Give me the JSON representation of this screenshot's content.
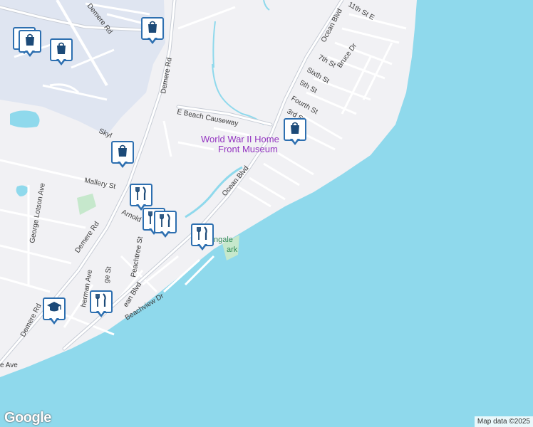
{
  "map": {
    "colors": {
      "land": "#f1f1f4",
      "water": "#8fd9ec",
      "marsh": "#dfe5f1",
      "road": "#ffffff",
      "major_road": "#c8cdd6",
      "park": "#c6e8cc",
      "pin_border": "#2d6fb0",
      "pin_icon": "#1c4a78",
      "poi_text": "#9334c0"
    },
    "streets": {
      "demere_rd_top": "Demere Rd",
      "demere_rd_mid": "Demere Rd",
      "demere_rd_lower": "Demere Rd",
      "demere_rd_bottom": "Demere Rd",
      "e_beach_causeway": "E Beach Causeway",
      "ocean_blvd_upper": "Ocean Blvd",
      "ocean_blvd_mid": "Ocean Blvd",
      "ocean_blvd_lower": "ean Blvd",
      "mallery_st": "Mallery St",
      "george_lotson_ave": "George Lotson Ave",
      "skyl": "Skyl",
      "arnold": "Arnold",
      "peachtree_st": "Peachtree St",
      "ge_st": "ge St",
      "herman_ave": "herman Ave",
      "beachview_dr": "Beachview Dr",
      "e_ave": "e Ave",
      "eleventh_st": "11th St E",
      "seventh_st": "7th St",
      "bruce_dr": "Bruce Dr",
      "sixth_st": "Sixth St",
      "fifth_st": "5th St",
      "fourth_st": "Fourth St",
      "third_st": "3rd St"
    },
    "poi": {
      "museum_line1": "World War II Home",
      "museum_line2": "Front Museum",
      "park_line1": "ngale",
      "park_line2": "ark"
    },
    "pins": [
      {
        "type": "shopping-bag",
        "icon": "shopping-bag-icon"
      },
      {
        "type": "shopping-bag",
        "icon": "shopping-bag-icon"
      },
      {
        "type": "shopping-bag",
        "icon": "shopping-bag-icon"
      },
      {
        "type": "shopping-bag",
        "icon": "shopping-bag-icon"
      },
      {
        "type": "shopping-bag",
        "icon": "shopping-bag-icon"
      },
      {
        "type": "shopping-bag",
        "icon": "shopping-bag-icon"
      },
      {
        "type": "restaurant",
        "icon": "fork-knife-icon"
      },
      {
        "type": "restaurant",
        "icon": "fork-knife-icon"
      },
      {
        "type": "restaurant",
        "icon": "fork-knife-icon"
      },
      {
        "type": "restaurant",
        "icon": "fork-knife-icon"
      },
      {
        "type": "restaurant",
        "icon": "fork-knife-icon"
      },
      {
        "type": "school",
        "icon": "graduation-cap-icon"
      }
    ]
  },
  "branding": {
    "logo": "Google",
    "attribution": "Map data ©2025"
  }
}
